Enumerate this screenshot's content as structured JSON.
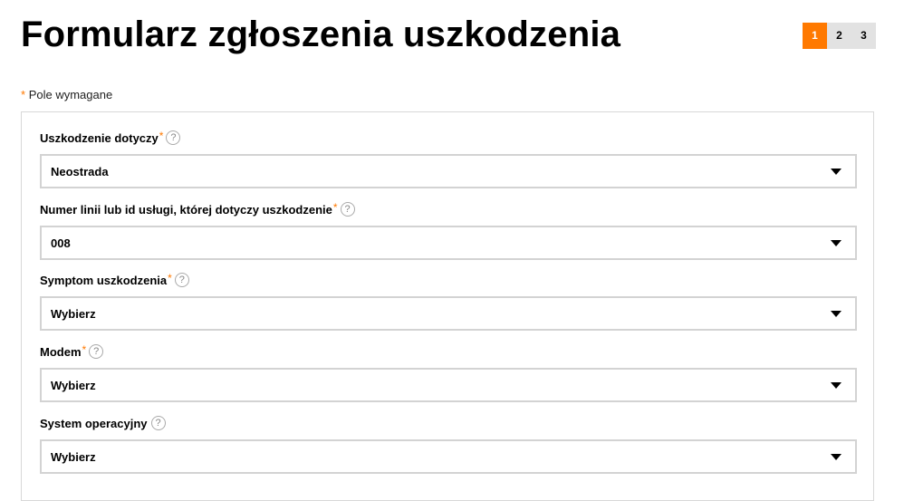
{
  "header": {
    "title": "Formularz zgłoszenia uszkodzenia",
    "steps": [
      "1",
      "2",
      "3"
    ],
    "active_step": "1"
  },
  "required_note": {
    "star": "*",
    "text": "Pole wymagane"
  },
  "fields": [
    {
      "label": "Uszkodzenie dotyczy",
      "required_mark": "*",
      "help": "?",
      "value": "Neostrada"
    },
    {
      "label": "Numer linii lub id usługi, której dotyczy uszkodzenie",
      "required_mark": "*",
      "help": "?",
      "value": "008"
    },
    {
      "label": "Symptom uszkodzenia",
      "required_mark": "*",
      "help": "?",
      "value": "Wybierz"
    },
    {
      "label": "Modem",
      "required_mark": "*",
      "help": "?",
      "value": "Wybierz"
    },
    {
      "label": "System operacyjny",
      "required_mark": "",
      "help": "?",
      "value": "Wybierz"
    }
  ],
  "colors": {
    "accent": "#ff7900",
    "step_inactive": "#e2e2e2",
    "border": "#d3d3d3"
  }
}
